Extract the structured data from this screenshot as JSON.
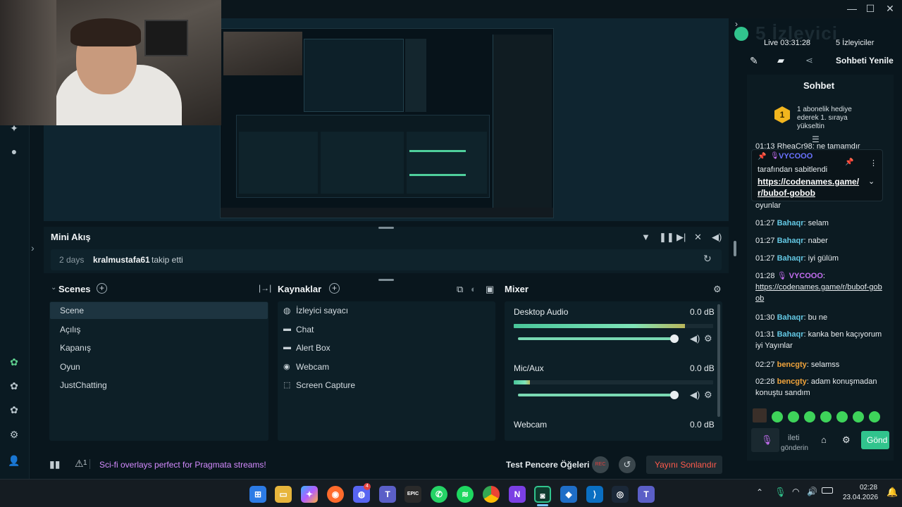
{
  "window": {
    "controls": [
      "—",
      "☐",
      "✕"
    ]
  },
  "viewers": {
    "big": "5 İzleyici",
    "live": "Live 03:31:28",
    "count": "5 İzleyiciler"
  },
  "chat_header": {
    "refresh": "Sohbeti Yenile",
    "title": "Sohbet",
    "hype_number": "1",
    "hype_text": "1 abonelik hediye ederek 1. sıraya yükseltin",
    "pinned_user": "VYCOOO",
    "pinned_by": "tarafından sabitlendi",
    "pinned_link": "https://codenames.game/r/bubof-gobob",
    "partial_top": "01:13 RheaCr98: ne tamamdır",
    "partial_after": "oyunlar"
  },
  "chat_messages": [
    {
      "time": "01:27",
      "user": "Bahaqr",
      "text": "selam",
      "color": "green"
    },
    {
      "time": "01:27",
      "user": "Bahaqr",
      "text": "naber",
      "color": "green"
    },
    {
      "time": "01:27",
      "user": "Bahaqr",
      "text": "iyi gülüm",
      "color": "green"
    },
    {
      "time": "01:28",
      "user": "VYCOOO",
      "text": "https://codenames.game/r/bubof-gobob",
      "color": "purple"
    },
    {
      "time": "01:30",
      "user": "Bahaqr",
      "text": "bu ne",
      "color": "green"
    },
    {
      "time": "01:31",
      "user": "Bahaqr",
      "text": "kanka ben kaçıyorum iyi Yayınlar",
      "color": "green"
    },
    {
      "time": "02:27",
      "user": "bencgty",
      "text": "selamss",
      "color": "orange"
    },
    {
      "time": "02:28",
      "user": "bencgty",
      "text": "adam konuşmadan konuştu sandım",
      "color": "orange"
    }
  ],
  "chat_footer": {
    "send": "Gönd",
    "send_hint": "gönderin",
    "input_hint": "ileti"
  },
  "minifeed": {
    "title": "Mini Akış",
    "time": "2 days",
    "user": "kralmustafa61",
    "action": "takip etti"
  },
  "scenes": {
    "title": "Scenes",
    "items": [
      "Scene",
      "Açılış",
      "Kapanış",
      "Oyun",
      "JustChatting"
    ]
  },
  "sources": {
    "title": "Kaynaklar",
    "items": [
      {
        "label": "İzleyici sayacı",
        "icon": "globe-icon"
      },
      {
        "label": "Chat",
        "icon": "chat-icon"
      },
      {
        "label": "Alert Box",
        "icon": "alert-box-icon"
      },
      {
        "label": "Webcam",
        "icon": "webcam-icon"
      },
      {
        "label": "Screen Capture",
        "icon": "screen-capture-icon"
      }
    ]
  },
  "mixer": {
    "title": "Mixer",
    "channels": [
      {
        "name": "Desktop Audio",
        "db": "0.0 dB",
        "level": 0.86,
        "volume": 1.0
      },
      {
        "name": "Mic/Aux",
        "db": "0.0 dB",
        "level": 0.08,
        "volume": 1.0
      },
      {
        "name": "Webcam",
        "db": "0.0 dB",
        "level": 0,
        "volume": 1.0
      }
    ]
  },
  "footer": {
    "alert_count": "1",
    "promo": "Sci-fi overlays perfect for Pragmata streams!",
    "test_label": "Test Pencere Öğeleri",
    "rec": "REC",
    "end_stream": "Yayını Sonlandır"
  },
  "taskbar": {
    "time": "02:28",
    "date": "23.04.2026",
    "discord_badge": "4",
    "epic": "EPIC"
  },
  "colors": {
    "bg": "#09161d",
    "accent_green": "#31c48d",
    "end_red": "#e1413f",
    "promo_purple": "#d48bff"
  }
}
